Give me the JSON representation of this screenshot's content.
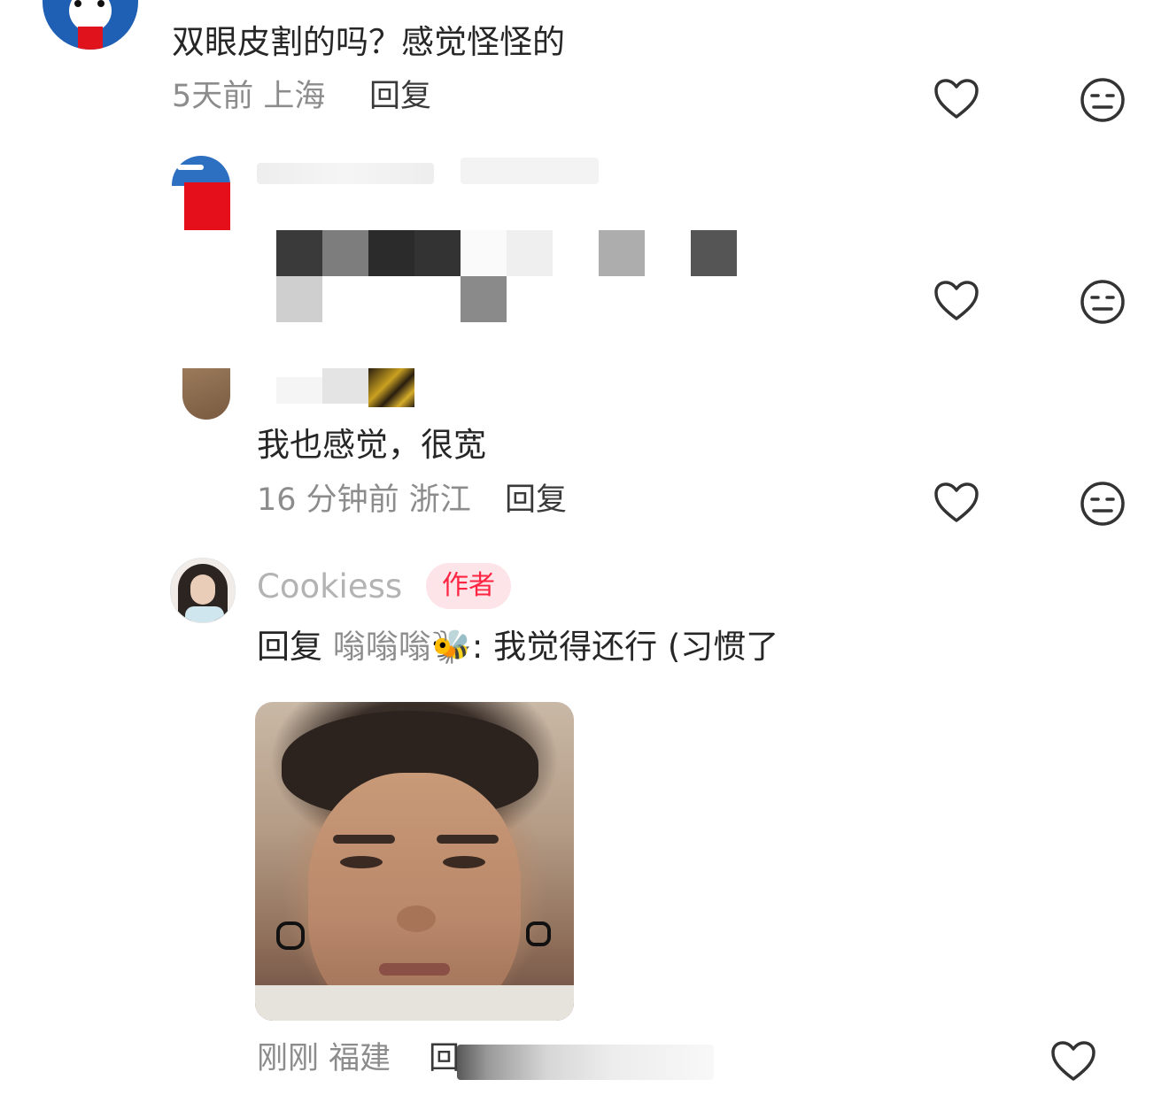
{
  "comments": [
    {
      "text": "双眼皮割的吗？感觉怪怪的",
      "meta": "5天前 上海",
      "reply_label": "回复"
    },
    {
      "text": "我也感觉，很宽",
      "meta": "16 分钟前 浙江",
      "reply_label": "回复"
    },
    {
      "author": "Cookiess",
      "badge": "作者",
      "reply_prefix": "回复",
      "reply_to": "嗡嗡嗡🐝",
      "text": ": 我觉得还行 (习惯了",
      "meta": "刚刚 福建",
      "reply_label": "回"
    }
  ],
  "icons": {
    "like": "heart-icon",
    "dislike": "meh-face-icon"
  },
  "colors": {
    "badge_text": "#ff2442",
    "badge_bg": "#fde4e8",
    "meta": "#8c8c8c",
    "name": "#b3b3b3"
  }
}
